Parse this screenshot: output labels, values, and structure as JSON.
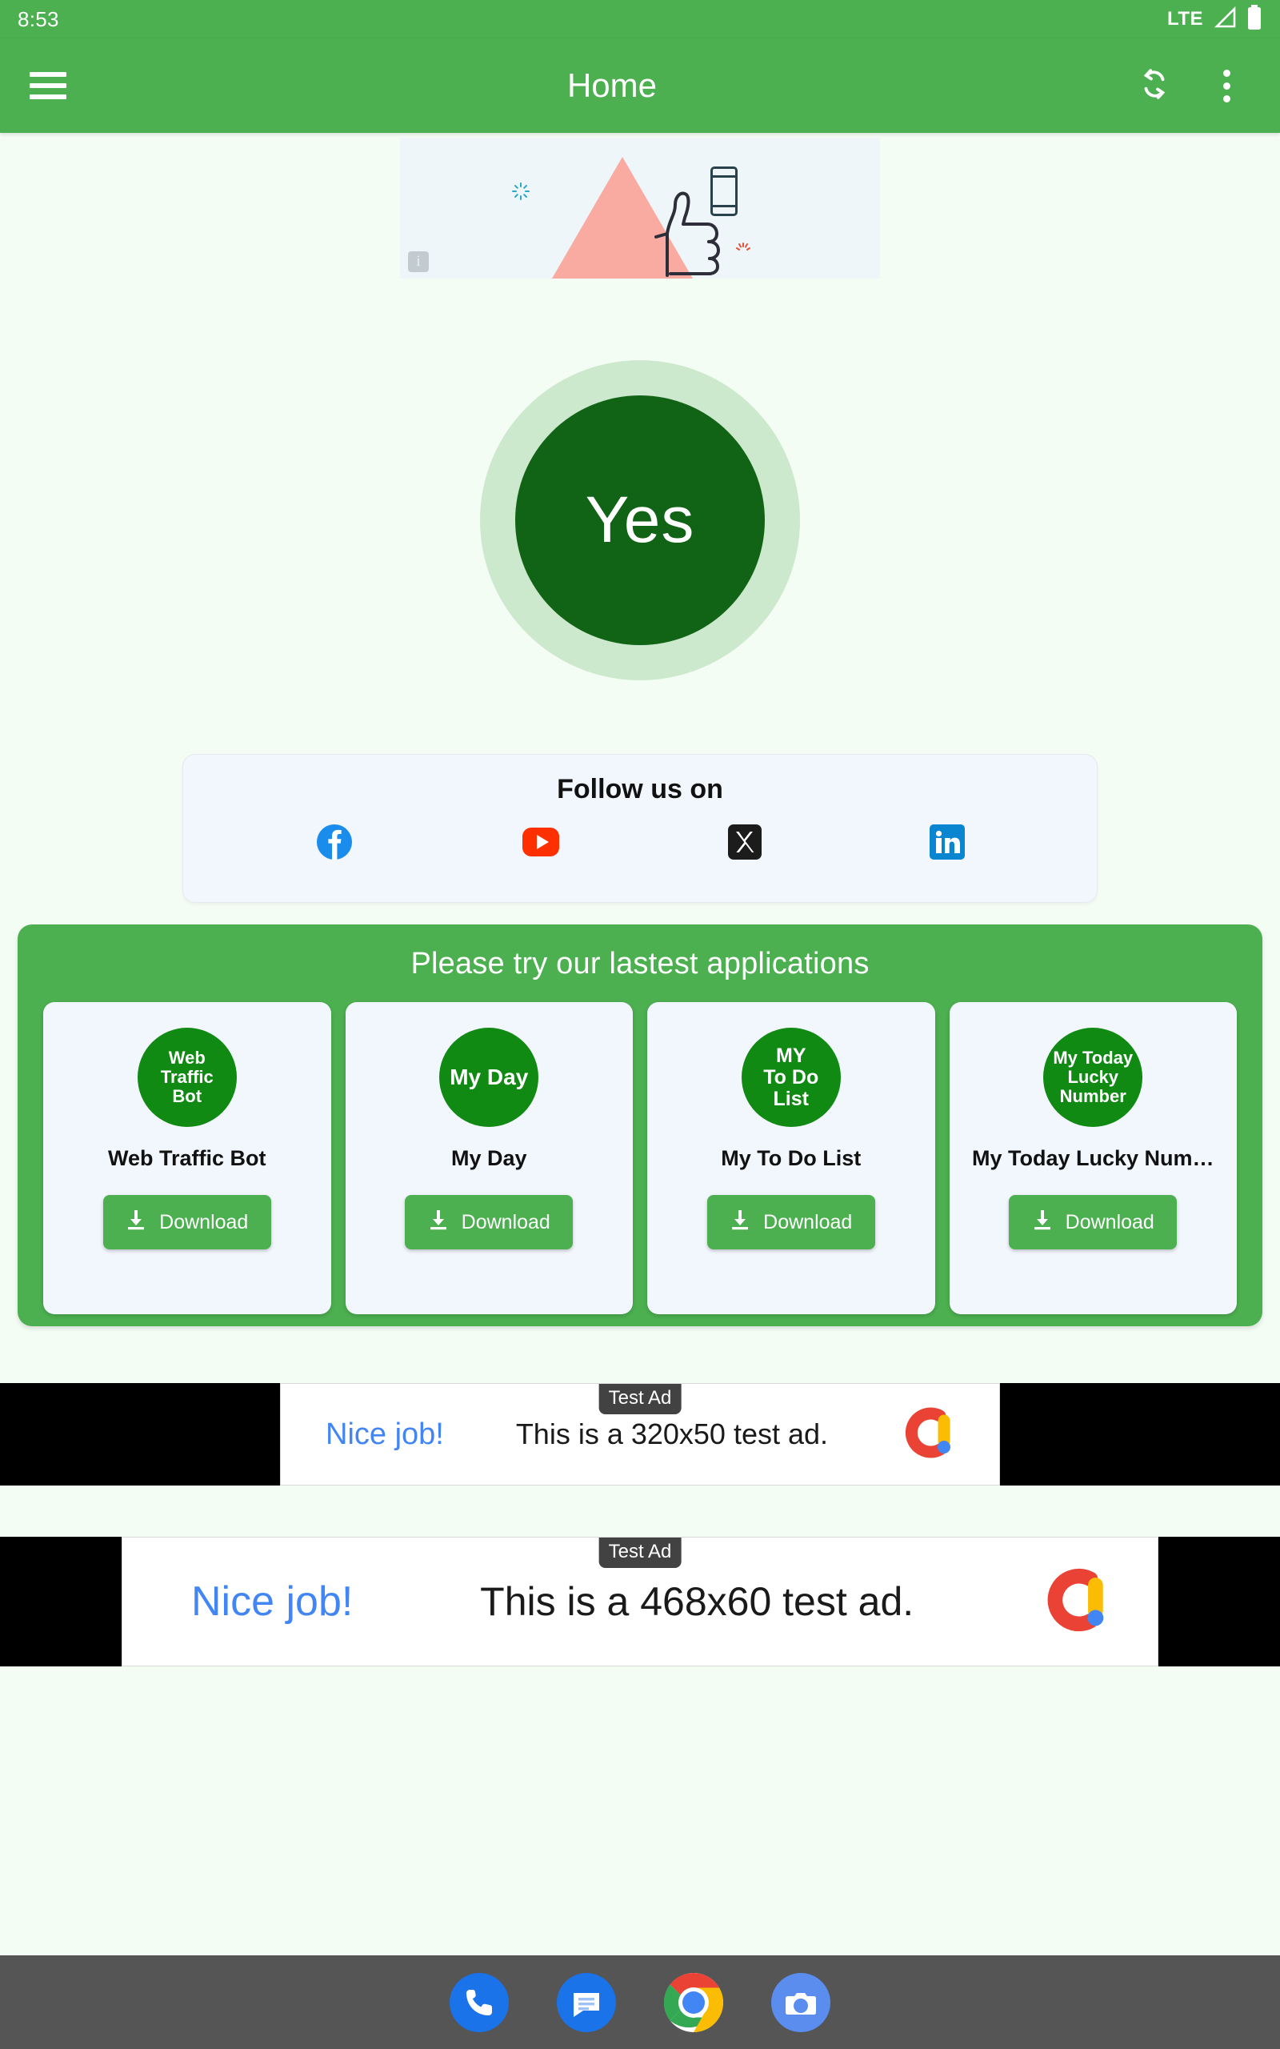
{
  "status_bar": {
    "time": "8:53",
    "network": "LTE",
    "signal_icon": "signal-triangle-icon",
    "battery_icon": "battery-icon"
  },
  "app_bar": {
    "menu_icon": "hamburger-menu-icon",
    "title": "Home",
    "refresh_icon": "sync-refresh-icon",
    "overflow_icon": "overflow-menu-icon"
  },
  "top_ad": {
    "info_badge": "i",
    "illustration": "thumbs-up-triangle-phone-illustration"
  },
  "yes_button": {
    "label": "Yes",
    "core_color": "#116316",
    "ring_color": "#cde9cd"
  },
  "follow": {
    "title": "Follow us on",
    "socials": [
      {
        "name": "facebook",
        "color": "#1A8CEC"
      },
      {
        "name": "youtube",
        "color": "#FF3000"
      },
      {
        "name": "x-twitter",
        "color": "#1C1C1C"
      },
      {
        "name": "linkedin",
        "color": "#0A85D0"
      }
    ]
  },
  "apps_section": {
    "title": "Please try our lastest applications",
    "panel_color": "#4CAF50",
    "apps": [
      {
        "logo_text": "Web\nTraffic\nBot",
        "name": "Web Traffic Bot",
        "download_label": "Download",
        "logo_size": "sz-sm"
      },
      {
        "logo_text": "My Day",
        "name": "My Day",
        "download_label": "Download",
        "logo_size": "sz-lg"
      },
      {
        "logo_text": "MY\nTo Do\nList",
        "name": "My To Do List",
        "download_label": "Download",
        "logo_size": "sz-md"
      },
      {
        "logo_text": "My Today\nLucky\nNumber",
        "name": "My Today Lucky Num…",
        "download_label": "Download",
        "logo_size": "sz-sm"
      }
    ]
  },
  "ads": [
    {
      "badge": "Test Ad",
      "headline": "Nice job!",
      "body": "This is a 320x50 test ad.",
      "logo": "admob-logo"
    },
    {
      "badge": "Test Ad",
      "headline": "Nice job!",
      "body": "This is a 468x60 test ad.",
      "logo": "admob-logo"
    }
  ],
  "dock": {
    "items": [
      {
        "name": "phone",
        "color": "#1A73E8"
      },
      {
        "name": "messages",
        "color": "#1A73E8"
      },
      {
        "name": "chrome",
        "color": "#ffffff"
      },
      {
        "name": "camera",
        "color": "#5B8DEF"
      }
    ]
  }
}
